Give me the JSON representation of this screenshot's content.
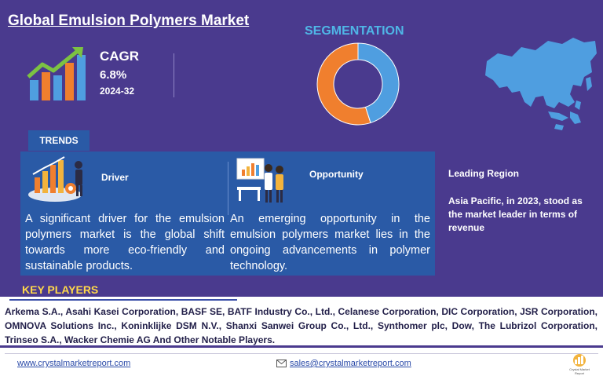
{
  "header": {
    "title": "Global Emulsion Polymers Market"
  },
  "cagr": {
    "label": "CAGR",
    "value": "6.8%",
    "period": "2024-32"
  },
  "segmentation": {
    "title": "SEGMENTATION",
    "chart_data": {
      "type": "pie",
      "values": [
        55,
        45
      ],
      "colors": [
        "#f07f2e",
        "#4f9ee0"
      ]
    }
  },
  "trends": {
    "tab_label": "TRENDS",
    "driver": {
      "title": "Driver",
      "text": "A significant driver for the emulsion polymers market is the global shift towards more eco-friendly and sustainable products."
    },
    "opportunity": {
      "title": "Opportunity",
      "text": "An emerging opportunity in the emulsion polymers market lies in the ongoing advancements in polymer technology."
    }
  },
  "leading_region": {
    "label": "Leading Region",
    "text": "Asia Pacific, in 2023, stood as the market leader in terms of revenue"
  },
  "key_players": {
    "title": "KEY PLAYERS",
    "text": "Arkema S.A., Asahi Kasei Corporation, BASF SE, BATF Industry Co., Ltd., Celanese Corporation, DIC Corporation, JSR Corporation, OMNOVA Solutions Inc., Koninklijke DSM N.V., Shanxi Sanwei Group Co., Ltd., Synthomer plc, Dow, The Lubrizol Corporation, Trinseo S.A., Wacker Chemie AG And Other Notable Players."
  },
  "footer": {
    "website": "www.crystalmarketreport.com",
    "email": "sales@crystalmarketreport.com",
    "logo_text": "Crystal Market Report"
  },
  "colors": {
    "background": "#4a3a8e",
    "panel": "#2a5aa6",
    "accent_orange": "#f07f2e",
    "accent_blue": "#4f9ee0",
    "key_players_title": "#ffd84a"
  },
  "icons": [
    "growth-chart-icon",
    "driver-illustration-icon",
    "opportunity-illustration-icon",
    "asia-map-icon",
    "email-icon",
    "company-logo-icon"
  ]
}
